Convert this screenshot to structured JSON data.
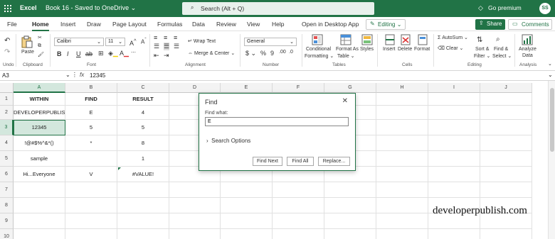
{
  "titlebar": {
    "app": "Excel",
    "book": "Book 16",
    "saved": "Saved to OneDrive",
    "search_placeholder": "Search (Alt + Q)",
    "premium": "Go premium",
    "avatar": "SS"
  },
  "tabs": [
    "File",
    "Home",
    "Insert",
    "Draw",
    "Page Layout",
    "Formulas",
    "Data",
    "Review",
    "View",
    "Help"
  ],
  "open_desktop": "Open in Desktop App",
  "editing": "Editing",
  "share": "Share",
  "comments": "Comments",
  "ribbon": {
    "undo": "Undo",
    "clipboard": "Clipboard",
    "paste": "Paste",
    "font_name": "Calibri",
    "font_size": "11",
    "font": "Font",
    "wrap": "Wrap Text",
    "merge": "Merge & Center",
    "alignment": "Alignment",
    "number_format": "General",
    "number": "Number",
    "cond_fmt": "Conditional",
    "cond_fmt2": "Formatting",
    "fmt_table": "Format As",
    "fmt_table2": "Table",
    "styles": "Styles",
    "tables": "Tables",
    "insert": "Insert",
    "delete": "Delete",
    "format": "Format",
    "cells": "Cells",
    "autosum": "AutoSum",
    "clear": "Clear",
    "sort": "Sort &",
    "sort2": "Filter",
    "find": "Find &",
    "find2": "Select",
    "editing": "Editing",
    "analyze": "Analyze",
    "analyze2": "Data",
    "analysis": "Analysis"
  },
  "formula_bar": {
    "ref": "A3",
    "fx": "fx",
    "value": "12345"
  },
  "sheet": {
    "cols": [
      "A",
      "B",
      "C",
      "D",
      "E",
      "F",
      "G",
      "H",
      "I",
      "J"
    ],
    "rows": [
      "1",
      "2",
      "3",
      "4",
      "5",
      "6",
      "7",
      "8",
      "9",
      "10"
    ],
    "data": [
      [
        "WITHIN",
        "FIND",
        "RESULT"
      ],
      [
        "DEVELOPERPUBLISH",
        "E",
        "4"
      ],
      [
        "12345",
        "5",
        "5"
      ],
      [
        "!@#$%^&*()",
        "*",
        "8"
      ],
      [
        "sample",
        "",
        "1"
      ],
      [
        "Hi...Everyone",
        "V",
        "#VALUE!"
      ]
    ]
  },
  "dialog": {
    "title": "Find",
    "find_what": "Find what:",
    "value": "E",
    "search_options": "Search Options",
    "find_next": "Find Next",
    "find_all": "Find All",
    "replace": "Replace..."
  },
  "watermark": "developerpublish.com"
}
